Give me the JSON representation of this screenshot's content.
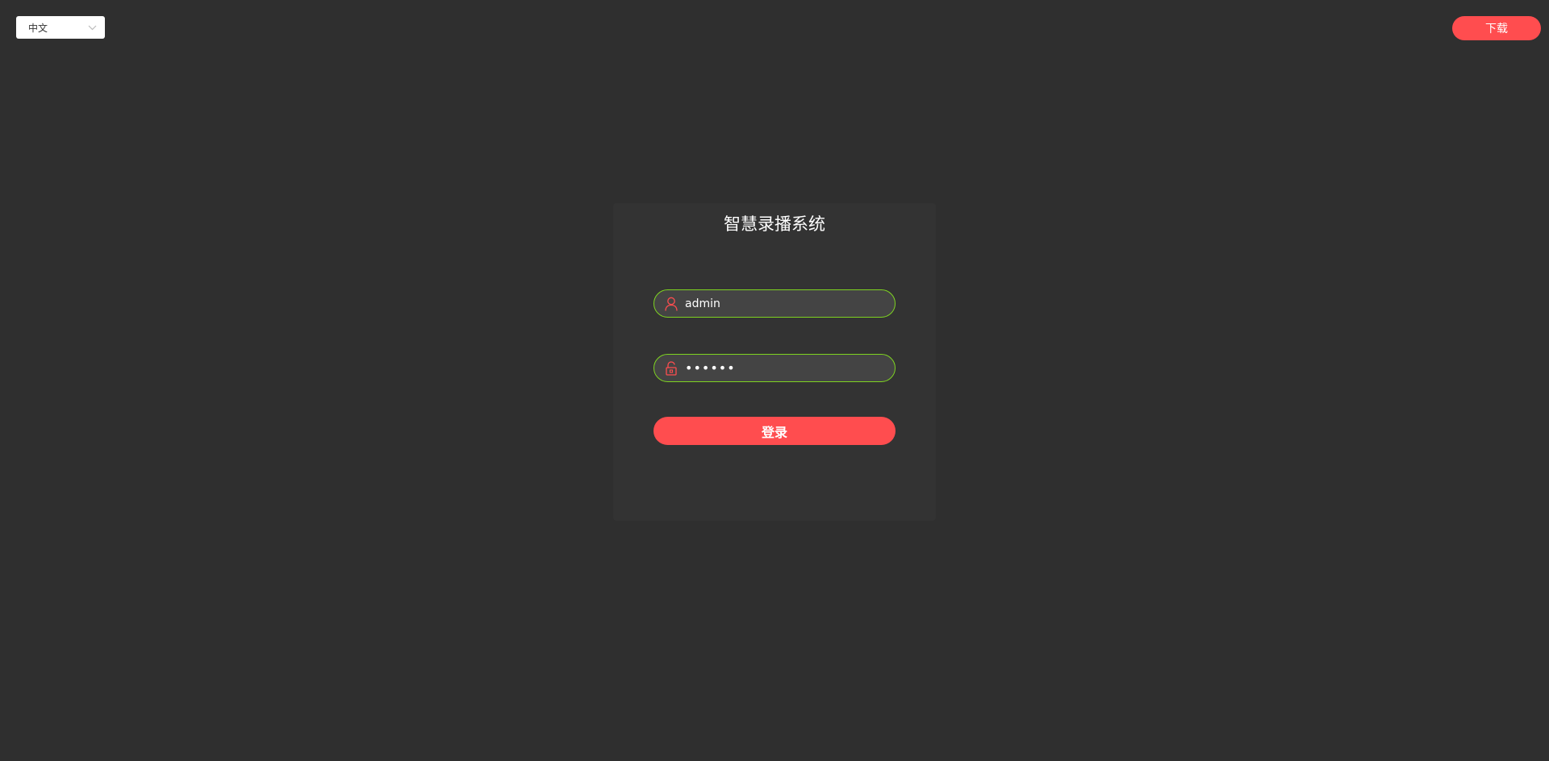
{
  "header": {
    "language": {
      "value": "中文",
      "icon": "chevron-down-icon"
    },
    "download_label": "下载"
  },
  "login": {
    "title": "智慧录播系统",
    "username": {
      "value": "admin",
      "icon": "user-icon"
    },
    "password": {
      "value": "••••••",
      "icon": "lock-icon"
    },
    "submit_label": "登录"
  },
  "colors": {
    "background": "#2f2f2f",
    "card": "#333333",
    "accent": "#ff4d4f",
    "field_border": "#7ed321",
    "field_bg": "#444444"
  }
}
